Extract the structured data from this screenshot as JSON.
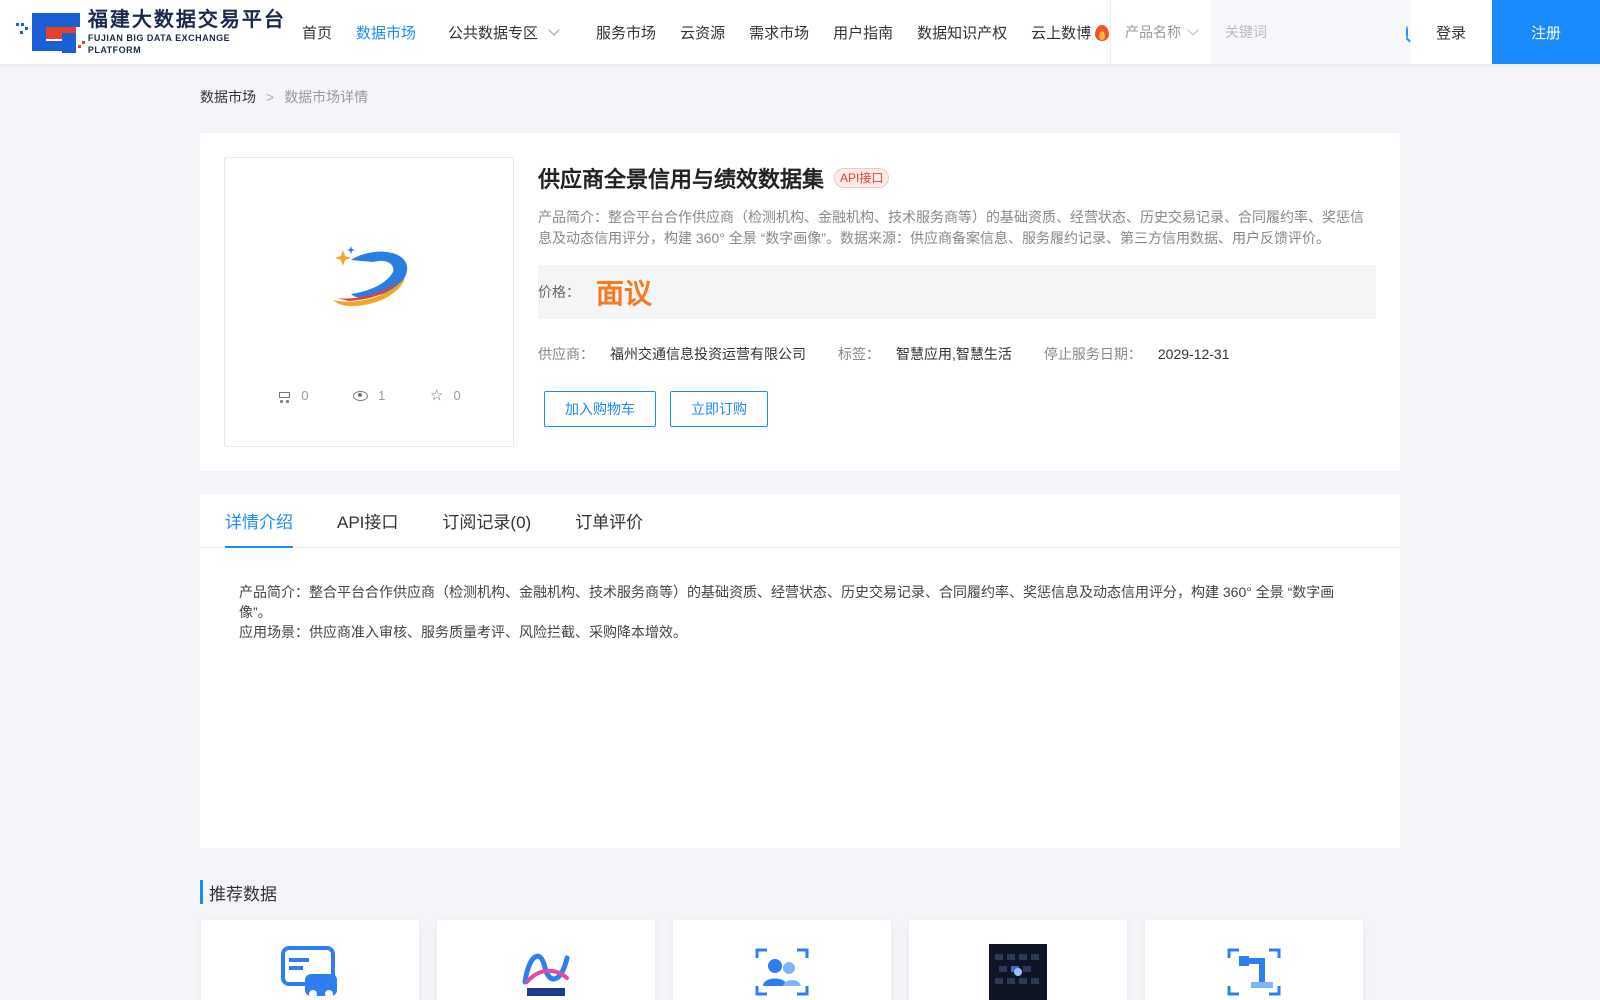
{
  "header": {
    "logo_cn": "福建大数据交易平台",
    "logo_en": "FUJIAN BIG DATA EXCHANGE  PLATFORM",
    "nav": [
      {
        "label": "首页",
        "active": false
      },
      {
        "label": "数据市场",
        "active": true
      },
      {
        "label": "公共数据专区",
        "active": false,
        "dropdown": true
      },
      {
        "label": "服务市场",
        "active": false
      },
      {
        "label": "云资源",
        "active": false
      },
      {
        "label": "需求市场",
        "active": false
      },
      {
        "label": "用户指南",
        "active": false
      },
      {
        "label": "数据知识产权",
        "active": false
      },
      {
        "label": "云上数博",
        "active": false,
        "icon": "fire-icon"
      }
    ],
    "search_type": "产品名称",
    "search_placeholder": "关键词",
    "login": "登录",
    "register": "注册",
    "accent_color": "#1a8bff"
  },
  "breadcrumb": {
    "root": "数据市场",
    "separator": ">",
    "current": "数据市场详情"
  },
  "product": {
    "title": "供应商全景信用与绩效数据集",
    "type_badge": "API接口",
    "intro": "产品简介：整合平台合作供应商（检测机构、金融机构、技术服务商等）的基础资质、经营状态、历史交易记录、合同履约率、奖惩信息及动态信用评分，构建 360° 全景 “数字画像”。数据来源：供应商备案信息、服务履约记录、第三方信用数据、用户反馈评价。",
    "price_label": "价格：",
    "price_value": "面议",
    "price_color": "#f57b22",
    "supplier_label": "供应商：",
    "supplier_value": "福州交通信息投资运营有限公司",
    "tags_label": "标签：",
    "tags_value": "智慧应用,智慧生活",
    "stop_date_label": "停止服务日期：",
    "stop_date_value": "2029-12-31",
    "add_cart": "加入购物车",
    "subscribe": "立即订购",
    "stats": {
      "cart": "0",
      "views": "1",
      "favorites": "0"
    }
  },
  "detail": {
    "tabs": [
      {
        "label": "详情介绍",
        "active": true
      },
      {
        "label": "API接口",
        "active": false
      },
      {
        "label": "订阅记录(0)",
        "active": false
      },
      {
        "label": "订单评价",
        "active": false
      }
    ],
    "body_line1": "产品简介：整合平台合作供应商（检测机构、金融机构、技术服务商等）的基础资质、经营状态、历史交易记录、合同履约率、奖惩信息及动态信用评分，构建 360° 全景 “数字画像”。",
    "body_line2": "应用场景：供应商准入审核、服务质量考评、风险拦截、采购降本增效。"
  },
  "recommend": {
    "title": "推荐数据",
    "cards": [
      {
        "icon": "car-card-icon"
      },
      {
        "icon": "anjin-data-logo"
      },
      {
        "icon": "users-scan-icon"
      },
      {
        "icon": "keyboard-photo"
      },
      {
        "icon": "robot-arm-scan-icon"
      }
    ]
  }
}
